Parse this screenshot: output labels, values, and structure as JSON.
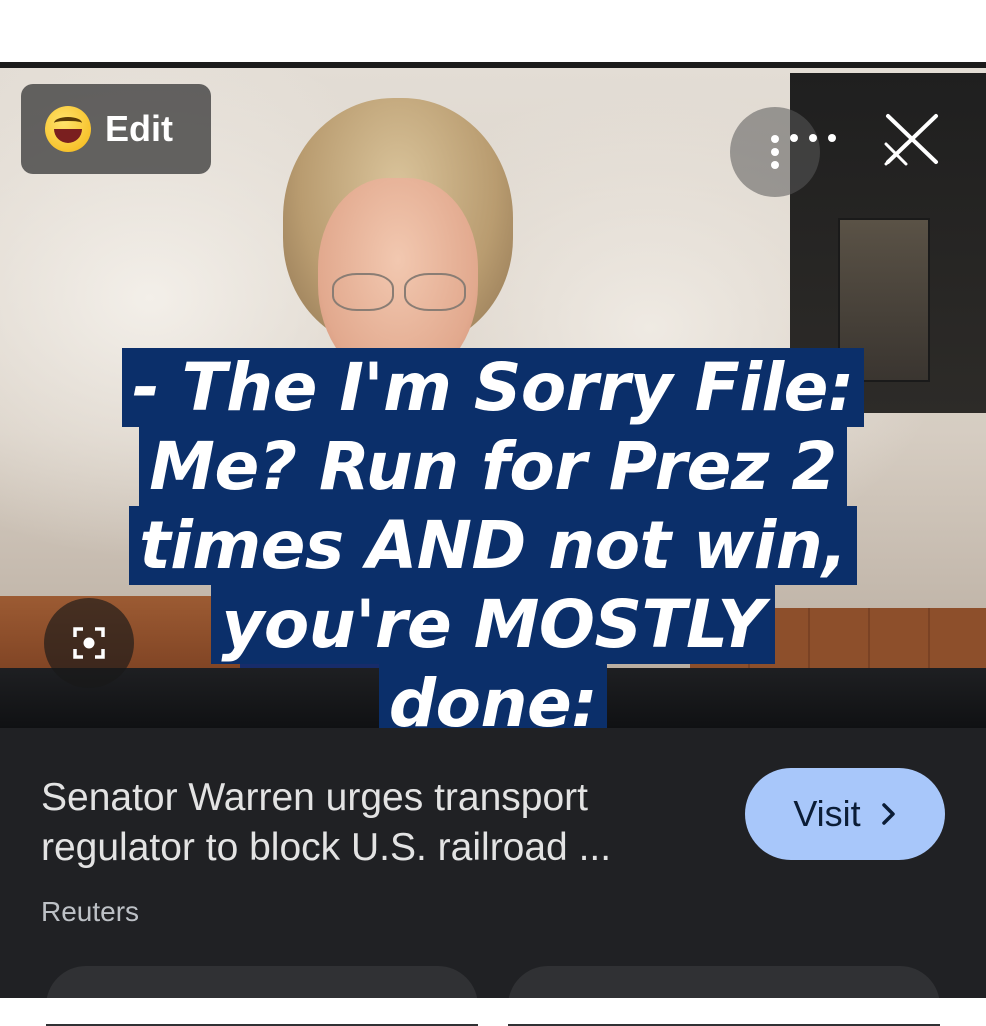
{
  "overlay": {
    "edit_label": "Edit",
    "emoji_icon": "grinning-face-emoji",
    "more_icon": "more-options-icon",
    "close_icon": "close-icon",
    "lens_icon": "google-lens-icon"
  },
  "caption": {
    "lines": [
      "- The I'm Sorry File:",
      "Me?  Run for Prez 2",
      "times AND not win,",
      "you're MOSTLY",
      "done:"
    ]
  },
  "result": {
    "headline": "Senator Warren urges transport regulator to block U.S. railroad ...",
    "source": "Reuters",
    "visit_label": "Visit",
    "visit_icon": "chevron-right-icon"
  },
  "colors": {
    "caption_bg": "#0b2f6a",
    "panel_bg": "#202124",
    "visit_bg": "#a8c7fa"
  }
}
